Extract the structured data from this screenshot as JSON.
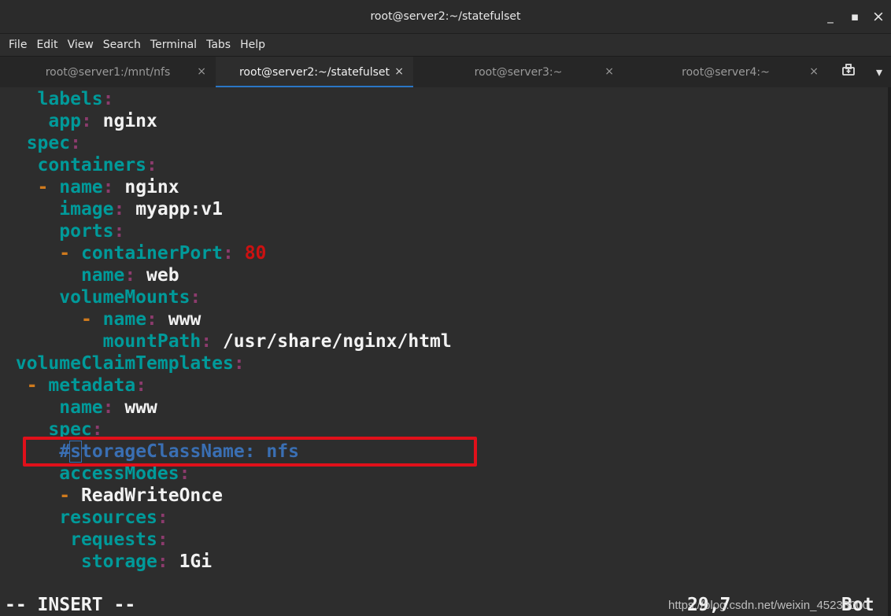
{
  "window": {
    "title": "root@server2:~/statefulset",
    "minimize": "_",
    "maximize": "▪",
    "close": "×"
  },
  "menu": [
    "File",
    "Edit",
    "View",
    "Search",
    "Terminal",
    "Tabs",
    "Help"
  ],
  "tabs": [
    {
      "label": "root@server1:/mnt/nfs",
      "active": false
    },
    {
      "label": "root@server2:~/statefulset",
      "active": true
    },
    {
      "label": "root@server3:~",
      "active": false
    },
    {
      "label": "root@server4:~",
      "active": false
    }
  ],
  "tab_close": "×",
  "new_tab_icon": "⎙",
  "tab_menu_icon": "▾",
  "editor": {
    "lines": [
      [
        [
          "   ",
          "v"
        ],
        [
          "labels",
          "k"
        ],
        [
          ":",
          "p"
        ]
      ],
      [
        [
          "    ",
          "v"
        ],
        [
          "app",
          "k"
        ],
        [
          ":",
          "p"
        ],
        [
          " nginx",
          "v"
        ]
      ],
      [
        [
          "  ",
          "v"
        ],
        [
          "spec",
          "k"
        ],
        [
          ":",
          "p"
        ]
      ],
      [
        [
          "   ",
          "v"
        ],
        [
          "containers",
          "k"
        ],
        [
          ":",
          "p"
        ]
      ],
      [
        [
          "   ",
          "v"
        ],
        [
          "-",
          "d"
        ],
        [
          " ",
          "v"
        ],
        [
          "name",
          "k"
        ],
        [
          ":",
          "p"
        ],
        [
          " nginx",
          "v"
        ]
      ],
      [
        [
          "     ",
          "v"
        ],
        [
          "image",
          "k"
        ],
        [
          ":",
          "p"
        ],
        [
          " myapp:v1",
          "v"
        ]
      ],
      [
        [
          "     ",
          "v"
        ],
        [
          "ports",
          "k"
        ],
        [
          ":",
          "p"
        ]
      ],
      [
        [
          "     ",
          "v"
        ],
        [
          "-",
          "d"
        ],
        [
          " ",
          "v"
        ],
        [
          "containerPort",
          "k"
        ],
        [
          ":",
          "p"
        ],
        [
          " ",
          "v"
        ],
        [
          "80",
          "n"
        ]
      ],
      [
        [
          "       ",
          "v"
        ],
        [
          "name",
          "k"
        ],
        [
          ":",
          "p"
        ],
        [
          " web",
          "v"
        ]
      ],
      [
        [
          "     ",
          "v"
        ],
        [
          "volumeMounts",
          "k"
        ],
        [
          ":",
          "p"
        ]
      ],
      [
        [
          "       ",
          "v"
        ],
        [
          "-",
          "d"
        ],
        [
          " ",
          "v"
        ],
        [
          "name",
          "k"
        ],
        [
          ":",
          "p"
        ],
        [
          " www",
          "v"
        ]
      ],
      [
        [
          "         ",
          "v"
        ],
        [
          "mountPath",
          "k"
        ],
        [
          ":",
          "p"
        ],
        [
          " /usr/share/nginx/html",
          "v"
        ]
      ],
      [
        [
          " ",
          "v"
        ],
        [
          "volumeClaimTemplates",
          "k"
        ],
        [
          ":",
          "p"
        ]
      ],
      [
        [
          "  ",
          "v"
        ],
        [
          "-",
          "d"
        ],
        [
          " ",
          "v"
        ],
        [
          "metadata",
          "k"
        ],
        [
          ":",
          "p"
        ]
      ],
      [
        [
          "     ",
          "v"
        ],
        [
          "name",
          "k"
        ],
        [
          ":",
          "p"
        ],
        [
          " www",
          "v"
        ]
      ],
      [
        [
          "    ",
          "v"
        ],
        [
          "spec",
          "k"
        ],
        [
          ":",
          "p"
        ]
      ],
      [
        [
          "     ",
          "c"
        ],
        [
          "#",
          "c"
        ],
        [
          "s",
          "cursor"
        ],
        [
          "torageClassName: nfs",
          "c"
        ]
      ],
      [
        [
          "     ",
          "v"
        ],
        [
          "accessModes",
          "k"
        ],
        [
          ":",
          "p"
        ]
      ],
      [
        [
          "     ",
          "v"
        ],
        [
          "-",
          "d"
        ],
        [
          " ReadWriteOnce",
          "v"
        ]
      ],
      [
        [
          "     ",
          "v"
        ],
        [
          "resources",
          "k"
        ],
        [
          ":",
          "p"
        ]
      ],
      [
        [
          "      ",
          "v"
        ],
        [
          "requests",
          "k"
        ],
        [
          ":",
          "p"
        ]
      ],
      [
        [
          "       ",
          "v"
        ],
        [
          "storage",
          "k"
        ],
        [
          ":",
          "p"
        ],
        [
          " 1Gi",
          "v"
        ]
      ]
    ],
    "status_mode": "-- INSERT --",
    "ruler_pos": "29,7",
    "ruler_scroll": "Bot"
  },
  "watermark": "https://blog.csdn.net/weixin_45233000",
  "colors": {
    "key": "#009a9a",
    "punct": "#8c3b6d",
    "dash": "#cf7a1d",
    "number": "#cc1111",
    "comment": "#3a6fb3",
    "highlight_box": "#e0101a"
  }
}
